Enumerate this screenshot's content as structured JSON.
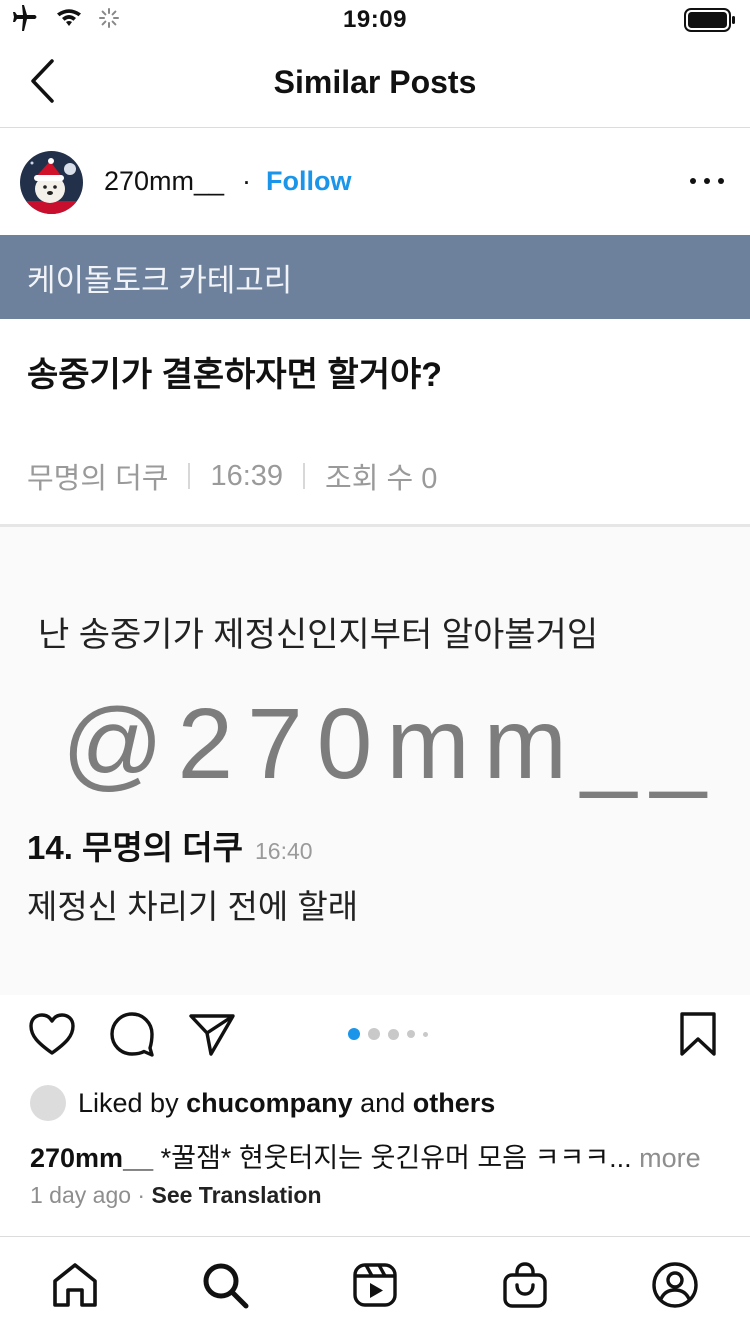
{
  "status_bar": {
    "time": "19:09",
    "icons": [
      "airplane-icon",
      "wifi-icon",
      "activity-spinner-icon",
      "battery-icon"
    ]
  },
  "nav": {
    "title": "Similar Posts",
    "back_icon": "chevron-left-icon"
  },
  "post": {
    "username": "270mm__",
    "separator": "·",
    "follow_label": "Follow",
    "more_icon": "ellipsis-icon",
    "image": {
      "category_bar": "케이돌토크 카테고리",
      "headline": "송중기가 결혼하자면 할거야?",
      "meta": {
        "author": "무명의 더쿠",
        "time": "16:39",
        "views": "조회 수 0"
      },
      "body_text": "난 송중기가 제정신인지부터 알아볼거임",
      "watermark": "@270mm__",
      "comment": {
        "name": "14. 무명의 더쿠",
        "time": "16:40",
        "text": "제정신 차리기 전에 할래"
      }
    },
    "carousel": {
      "count": 5,
      "active_index": 0
    },
    "likes": {
      "prefix": "Liked by",
      "user": "chucompany",
      "connector": "and",
      "others": "others"
    },
    "caption": {
      "user": "270mm__",
      "text": "*꿀잼* 현웃터지는 웃긴유머 모음 ㅋㅋㅋ...",
      "more_label": "more"
    },
    "timestamp": "1 day ago",
    "dot": "·",
    "see_translation": "See Translation"
  },
  "tab_bar": {
    "items": [
      "home-icon",
      "search-icon",
      "reels-icon",
      "shop-icon",
      "profile-icon"
    ]
  },
  "colors": {
    "accent": "#1a95ea",
    "category_bar": "#6d819d",
    "meta_gray": "#9a9a9a",
    "active_dot": "#1a95ea"
  }
}
